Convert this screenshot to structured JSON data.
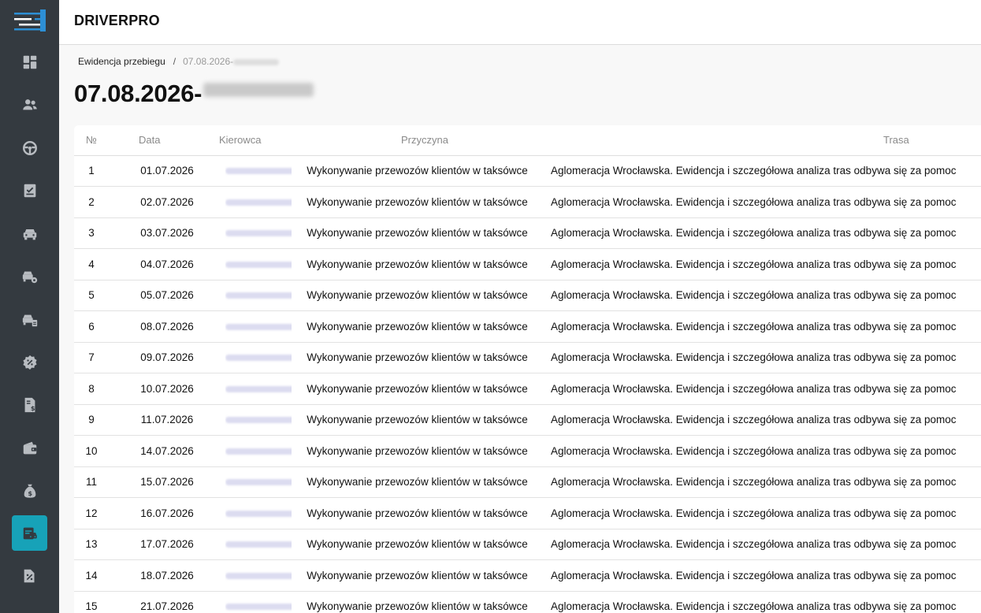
{
  "app": {
    "brand": "DRIVERPRO"
  },
  "sidebar": {
    "items": [
      {
        "icon": "dashboard-icon",
        "active": false
      },
      {
        "icon": "users-icon",
        "active": false
      },
      {
        "icon": "steering-wheel-icon",
        "active": false
      },
      {
        "icon": "checklist-icon",
        "active": false
      },
      {
        "icon": "car-icon",
        "active": false
      },
      {
        "icon": "car-settings-icon",
        "active": false
      },
      {
        "icon": "car-document-icon",
        "active": false
      },
      {
        "icon": "percent-badge-icon",
        "active": false
      },
      {
        "icon": "invoice-dollar-icon",
        "active": false
      },
      {
        "icon": "wallet-icon",
        "active": false
      },
      {
        "icon": "money-bag-icon",
        "active": false
      },
      {
        "icon": "mileage-log-icon",
        "active": true
      },
      {
        "icon": "discount-icon",
        "active": false
      }
    ],
    "accent_color": "#17a2b8",
    "background_color": "#343a40"
  },
  "breadcrumb": {
    "parent": "Ewidencja przebiegu",
    "separator": "/",
    "current": "07.08.2026-"
  },
  "page_title": "07.08.2026-",
  "table": {
    "columns": [
      "№",
      "Data",
      "Kierowca",
      "Przyczyna",
      "Trasa"
    ],
    "rows": [
      {
        "no": "1",
        "date": "01.07.2026",
        "reason": "Wykonywanie przewozów klientów w taksówce",
        "route": "Aglomeracja Wrocławska. Ewidencja i szczegółowa analiza tras odbywa się za pomoc"
      },
      {
        "no": "2",
        "date": "02.07.2026",
        "reason": "Wykonywanie przewozów klientów w taksówce",
        "route": "Aglomeracja Wrocławska. Ewidencja i szczegółowa analiza tras odbywa się za pomoc"
      },
      {
        "no": "3",
        "date": "03.07.2026",
        "reason": "Wykonywanie przewozów klientów w taksówce",
        "route": "Aglomeracja Wrocławska. Ewidencja i szczegółowa analiza tras odbywa się za pomoc"
      },
      {
        "no": "4",
        "date": "04.07.2026",
        "reason": "Wykonywanie przewozów klientów w taksówce",
        "route": "Aglomeracja Wrocławska. Ewidencja i szczegółowa analiza tras odbywa się za pomoc"
      },
      {
        "no": "5",
        "date": "05.07.2026",
        "reason": "Wykonywanie przewozów klientów w taksówce",
        "route": "Aglomeracja Wrocławska. Ewidencja i szczegółowa analiza tras odbywa się za pomoc"
      },
      {
        "no": "6",
        "date": "08.07.2026",
        "reason": "Wykonywanie przewozów klientów w taksówce",
        "route": "Aglomeracja Wrocławska. Ewidencja i szczegółowa analiza tras odbywa się za pomoc"
      },
      {
        "no": "7",
        "date": "09.07.2026",
        "reason": "Wykonywanie przewozów klientów w taksówce",
        "route": "Aglomeracja Wrocławska. Ewidencja i szczegółowa analiza tras odbywa się za pomoc"
      },
      {
        "no": "8",
        "date": "10.07.2026",
        "reason": "Wykonywanie przewozów klientów w taksówce",
        "route": "Aglomeracja Wrocławska. Ewidencja i szczegółowa analiza tras odbywa się za pomoc"
      },
      {
        "no": "9",
        "date": "11.07.2026",
        "reason": "Wykonywanie przewozów klientów w taksówce",
        "route": "Aglomeracja Wrocławska. Ewidencja i szczegółowa analiza tras odbywa się za pomoc"
      },
      {
        "no": "10",
        "date": "14.07.2026",
        "reason": "Wykonywanie przewozów klientów w taksówce",
        "route": "Aglomeracja Wrocławska. Ewidencja i szczegółowa analiza tras odbywa się za pomoc"
      },
      {
        "no": "11",
        "date": "15.07.2026",
        "reason": "Wykonywanie przewozów klientów w taksówce",
        "route": "Aglomeracja Wrocławska. Ewidencja i szczegółowa analiza tras odbywa się za pomoc"
      },
      {
        "no": "12",
        "date": "16.07.2026",
        "reason": "Wykonywanie przewozów klientów w taksówce",
        "route": "Aglomeracja Wrocławska. Ewidencja i szczegółowa analiza tras odbywa się za pomoc"
      },
      {
        "no": "13",
        "date": "17.07.2026",
        "reason": "Wykonywanie przewozów klientów w taksówce",
        "route": "Aglomeracja Wrocławska. Ewidencja i szczegółowa analiza tras odbywa się za pomoc"
      },
      {
        "no": "14",
        "date": "18.07.2026",
        "reason": "Wykonywanie przewozów klientów w taksówce",
        "route": "Aglomeracja Wrocławska. Ewidencja i szczegółowa analiza tras odbywa się za pomoc"
      },
      {
        "no": "15",
        "date": "21.07.2026",
        "reason": "Wykonywanie przewozów klientów w taksówce",
        "route": "Aglomeracja Wrocławska. Ewidencja i szczegółowa analiza tras odbywa się za pomoc"
      }
    ]
  }
}
